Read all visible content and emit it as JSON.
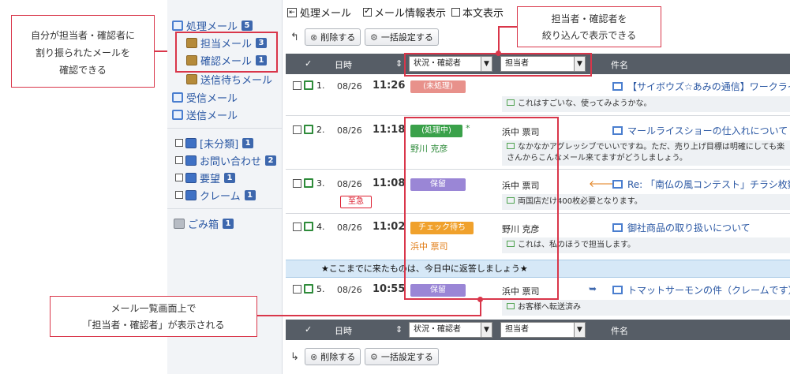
{
  "sidebar": {
    "items": [
      {
        "label": "処理メール",
        "badge": "5",
        "icon": "mail-process-icon"
      },
      {
        "label": "担当メール",
        "badge": "3",
        "icon": "assigned-mail-icon"
      },
      {
        "label": "確認メール",
        "badge": "1",
        "icon": "confirm-mail-icon"
      },
      {
        "label": "送信待ちメール",
        "badge": "",
        "icon": "outbox-icon"
      },
      {
        "label": "受信メール",
        "badge": "",
        "icon": "inbox-icon"
      },
      {
        "label": "送信メール",
        "badge": "",
        "icon": "sent-icon"
      },
      {
        "label": "[未分類]",
        "badge": "1",
        "icon": "folder-icon"
      },
      {
        "label": "お問い合わせ",
        "badge": "2",
        "icon": "folder-icon"
      },
      {
        "label": "要望",
        "badge": "1",
        "icon": "folder-icon"
      },
      {
        "label": "クレーム",
        "badge": "1",
        "icon": "folder-icon"
      },
      {
        "label": "ごみ箱",
        "badge": "1",
        "icon": "trash-icon"
      }
    ]
  },
  "toolbar": {
    "title": "処理メール",
    "show_info_label": "メール情報表示",
    "show_info_checked": true,
    "show_body_label": "本文表示",
    "show_body_checked": false,
    "delete_label": "削除する",
    "bulk_label": "一括設定する"
  },
  "table": {
    "headers": {
      "check": "✓",
      "date": "日時",
      "status_filter": "状況・確認者",
      "assignee_filter": "担当者",
      "subject": "件名"
    },
    "rows": [
      {
        "num": "1.",
        "date": "08/26",
        "time": "11:26",
        "status": "(未処理)",
        "status_color": "#e8918b",
        "confirmer": "",
        "assignee": "",
        "urgent": "",
        "subject": "【サイボウズ☆あみの通信】ワークライ",
        "preview": "これはすごいな、使ってみようかな。"
      },
      {
        "num": "2.",
        "date": "08/26",
        "time": "11:18",
        "status": "(処理中)",
        "status_color": "#3aa14a",
        "status_mark": "*",
        "confirmer": "野川 克彦",
        "assignee": "浜中 票司",
        "urgent": "",
        "subject": "マールライスショーの仕入れについて",
        "preview": "なかなかアグレッシブでいいですね。ただ、売り上げ目標は明確にしても楽さんからこんなメール来てますがどうしましょう。"
      },
      {
        "num": "3.",
        "date": "08/26",
        "time": "11:08",
        "status": "保留",
        "status_color": "#9a86d6",
        "confirmer": "",
        "assignee": "浜中 票司",
        "urgent": "至急",
        "subject": "Re: 「南仏の風コンテスト」チラシ枚数",
        "preview": "両国店だけ400枚必要となります。"
      },
      {
        "num": "4.",
        "date": "08/26",
        "time": "11:02",
        "status": "チェック待ち",
        "status_color": "#f0a12c",
        "confirmer": "浜中 票司",
        "assignee": "野川 克彦",
        "urgent": "",
        "subject": "御社商品の取り扱いについて",
        "preview": "これは、私のほうで担当します。"
      },
      {
        "num": "5.",
        "date": "08/26",
        "time": "10:55",
        "status": "保留",
        "status_color": "#9a86d6",
        "confirmer": "",
        "assignee": "浜中 票司",
        "urgent": "",
        "subject": "トマットサーモンの件（クレームです）",
        "preview": "お客様へ転送済み"
      }
    ],
    "notice": "★ここまでに来たものは、今日中に返答しましょう★"
  },
  "callouts": {
    "left_line1": "自分が担当者・確認者に",
    "left_line2": "割り振られたメールを",
    "left_line3": "確認できる",
    "top_line1": "担当者・確認者を",
    "top_line2": "絞り込んで表示できる",
    "bottom_line1": "メール一覧画面上で",
    "bottom_line2": "「担当者・確認者」が表示される"
  }
}
